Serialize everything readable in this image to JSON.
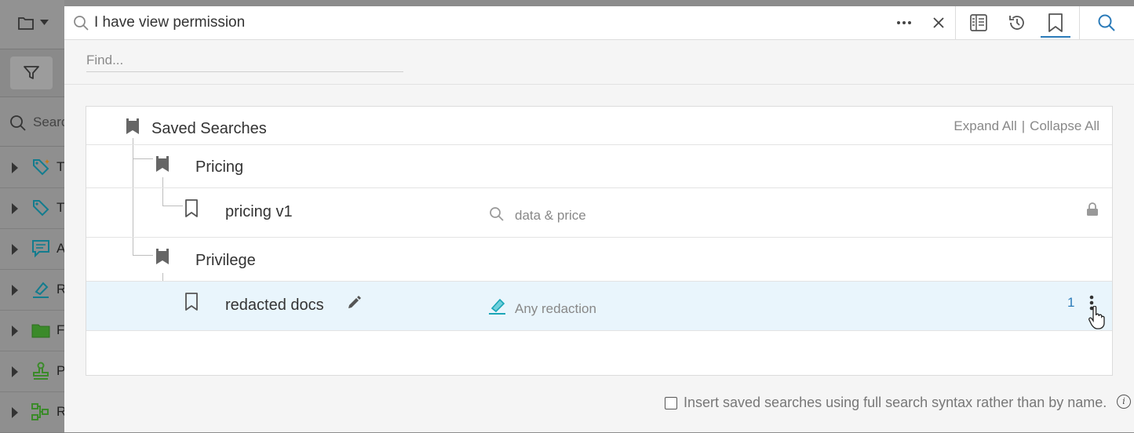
{
  "left_panel": {
    "search_placeholder": "Search",
    "items": [
      {
        "icon": "tag-sparkle-icon",
        "label": "T"
      },
      {
        "icon": "tag-icon",
        "label": "T"
      },
      {
        "icon": "comment-icon",
        "label": "A"
      },
      {
        "icon": "highlighter-icon",
        "label": "R"
      },
      {
        "icon": "folder-icon",
        "label": "F"
      },
      {
        "icon": "stamp-icon",
        "label": "P"
      },
      {
        "icon": "workflow-icon",
        "label": "R"
      }
    ]
  },
  "search_bar": {
    "query": "I have view permission"
  },
  "find": {
    "placeholder": "Find..."
  },
  "tree": {
    "root_label": "Saved Searches",
    "expand_all": "Expand All",
    "separator": "|",
    "collapse_all": "Collapse All",
    "folders": [
      {
        "label": "Pricing",
        "searches": [
          {
            "name": "pricing v1",
            "query_icon": "search-icon",
            "query": "data & price",
            "locked": true
          }
        ]
      },
      {
        "label": "Privilege",
        "searches": [
          {
            "name": "redacted docs",
            "query_icon": "highlighter-icon",
            "query": "Any redaction",
            "count": "1",
            "selected": true
          }
        ]
      }
    ]
  },
  "footer": {
    "checkbox_label": "Insert saved searches using full search syntax rather than by name.",
    "info": "i"
  },
  "colors": {
    "accent": "#2b7bb9",
    "selected_row": "#e9f5fc",
    "teal": "#1aa6b7"
  }
}
